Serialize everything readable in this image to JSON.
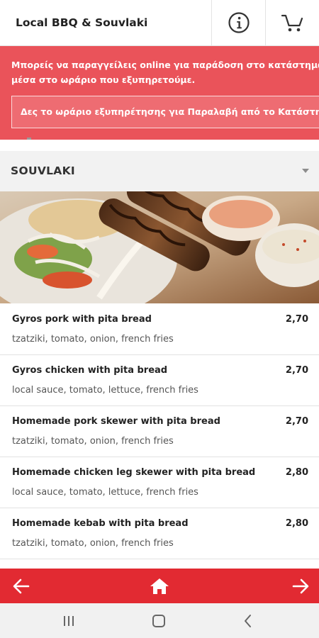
{
  "header": {
    "title": "Local BBQ & Souvlaki",
    "info_icon": "info-icon",
    "cart_icon": "cart-icon"
  },
  "notice": {
    "text": "Μπορείς να παραγγείλεις online για παράδοση στο κατάστημα\nμέσα στο ωράριο που εξυπηρετούμε.",
    "button_label": "Δες το ωράριο εξυπηρέτησης για Παραλαβή από το Κατάστημα"
  },
  "category": {
    "name": "SOUVLAKI",
    "chevron_icon": "chevron-down-icon"
  },
  "menu": {
    "items": [
      {
        "name": "Gyros pork with pita bread",
        "description": "tzatziki, tomato, onion, french fries",
        "price": "2,70"
      },
      {
        "name": "Gyros chicken with pita bread",
        "description": "local sauce, tomato, lettuce, french fries",
        "price": "2,70"
      },
      {
        "name": "Homemade pork skewer with pita bread",
        "description": "tzatziki, tomato, onion, french fries",
        "price": "2,70"
      },
      {
        "name": "Homemade chicken leg skewer with pita bread",
        "description": "local sauce, tomato, lettuce, french fries",
        "price": "2,80"
      },
      {
        "name": "Homemade kebab with pita bread",
        "description": "tzatziki, tomato, onion, french fries",
        "price": "2,80"
      }
    ]
  },
  "bottom_nav": {
    "back_icon": "arrow-left-icon",
    "home_icon": "home-icon",
    "forward_icon": "arrow-right-icon"
  },
  "system_bar": {
    "recents_icon": "recents-icon",
    "home_icon": "system-home-icon",
    "back_icon": "system-back-icon"
  },
  "colors": {
    "brand_red": "#e22a32",
    "notice_red": "#ea535a",
    "category_bg": "#f2f2f2"
  }
}
